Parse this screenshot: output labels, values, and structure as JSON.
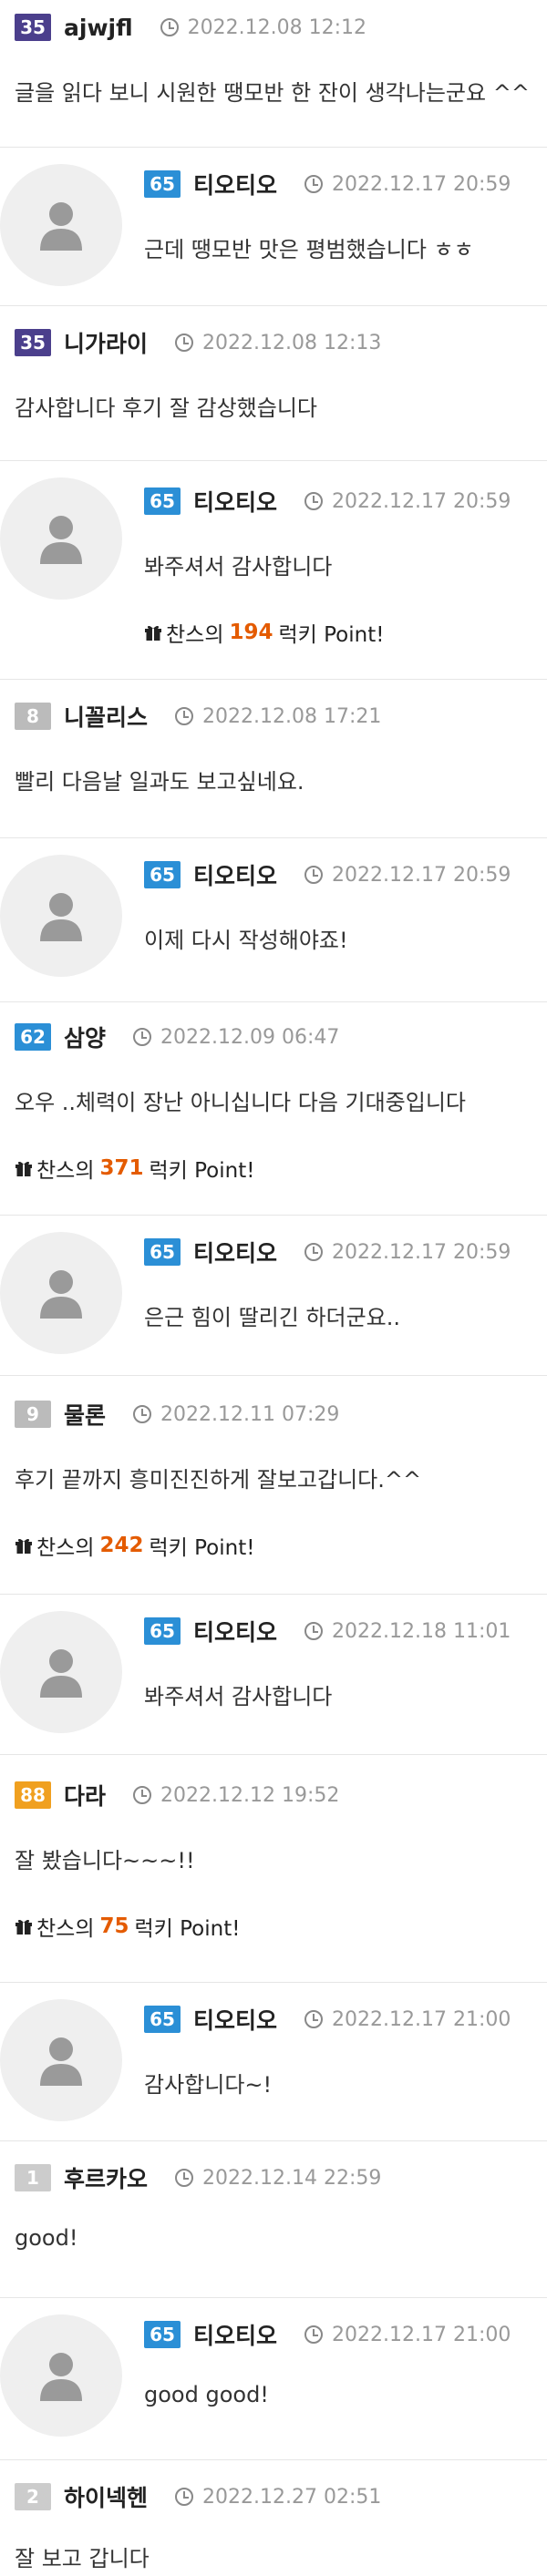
{
  "comments": [
    {
      "level": "35",
      "level_color": "#4b3f8c",
      "nick": "ajwjfl",
      "time": "2022.12.08 12:12",
      "text": "글을 읽다 보니 시원한 땡모반  한 잔이 생각나는군요 ^^"
    },
    {
      "level": "65",
      "level_color": "#2b8fd6",
      "nick": "티오티오",
      "time": "2022.12.17 20:59",
      "text": "근데 땡모반 맛은 평범했습니다 ㅎㅎ"
    },
    {
      "level": "35",
      "level_color": "#4b3f8c",
      "nick": "니가라이",
      "time": "2022.12.08 12:13",
      "text": "감사합니다 후기 잘 감상했습니다"
    },
    {
      "level": "65",
      "level_color": "#2b8fd6",
      "nick": "티오티오",
      "time": "2022.12.17 20:59",
      "text": "봐주셔서 감사합니다",
      "point_prefix": "찬스의",
      "point_value": "194",
      "point_suffix": "럭키 Point!"
    },
    {
      "level": "8",
      "level_color": "#bbbbbb",
      "nick": "니꼴리스",
      "time": "2022.12.08 17:21",
      "text": "빨리 다음날 일과도 보고싶네요."
    },
    {
      "level": "65",
      "level_color": "#2b8fd6",
      "nick": "티오티오",
      "time": "2022.12.17 20:59",
      "text": "이제 다시 작성해야죠!"
    },
    {
      "level": "62",
      "level_color": "#2b8fd6",
      "nick": "삼양",
      "time": "2022.12.09 06:47",
      "text": "오우 ..체력이 장난 아니십니다 다음 기대중입니다",
      "point_prefix": "찬스의",
      "point_value": "371",
      "point_suffix": "럭키 Point!"
    },
    {
      "level": "65",
      "level_color": "#2b8fd6",
      "nick": "티오티오",
      "time": "2022.12.17 20:59",
      "text": "은근 힘이 딸리긴 하더군요.."
    },
    {
      "level": "9",
      "level_color": "#bbbbbb",
      "nick": "물론",
      "time": "2022.12.11 07:29",
      "text": "후기 끝까지 흥미진진하게 잘보고갑니다.^^",
      "point_prefix": "찬스의",
      "point_value": "242",
      "point_suffix": "럭키 Point!"
    },
    {
      "level": "65",
      "level_color": "#2b8fd6",
      "nick": "티오티오",
      "time": "2022.12.18 11:01",
      "text": "봐주셔서 감사합니다"
    },
    {
      "level": "88",
      "level_color": "#f0a020",
      "nick": "다라",
      "time": "2022.12.12 19:52",
      "text": "잘 봤습니다~~~!!",
      "point_prefix": "찬스의",
      "point_value": "75",
      "point_suffix": "럭키 Point!"
    },
    {
      "level": "65",
      "level_color": "#2b8fd6",
      "nick": "티오티오",
      "time": "2022.12.17 21:00",
      "text": "감사합니다~!"
    },
    {
      "level": "1",
      "level_color": "#cccccc",
      "nick": "후르카오",
      "time": "2022.12.14 22:59",
      "text": "good!"
    },
    {
      "level": "65",
      "level_color": "#2b8fd6",
      "nick": "티오티오",
      "time": "2022.12.17 21:00",
      "text": "good good!"
    },
    {
      "level": "2",
      "level_color": "#cccccc",
      "nick": "하이넥헨",
      "time": "2022.12.27 02:51",
      "text": "잘 보고 갑니다"
    }
  ]
}
